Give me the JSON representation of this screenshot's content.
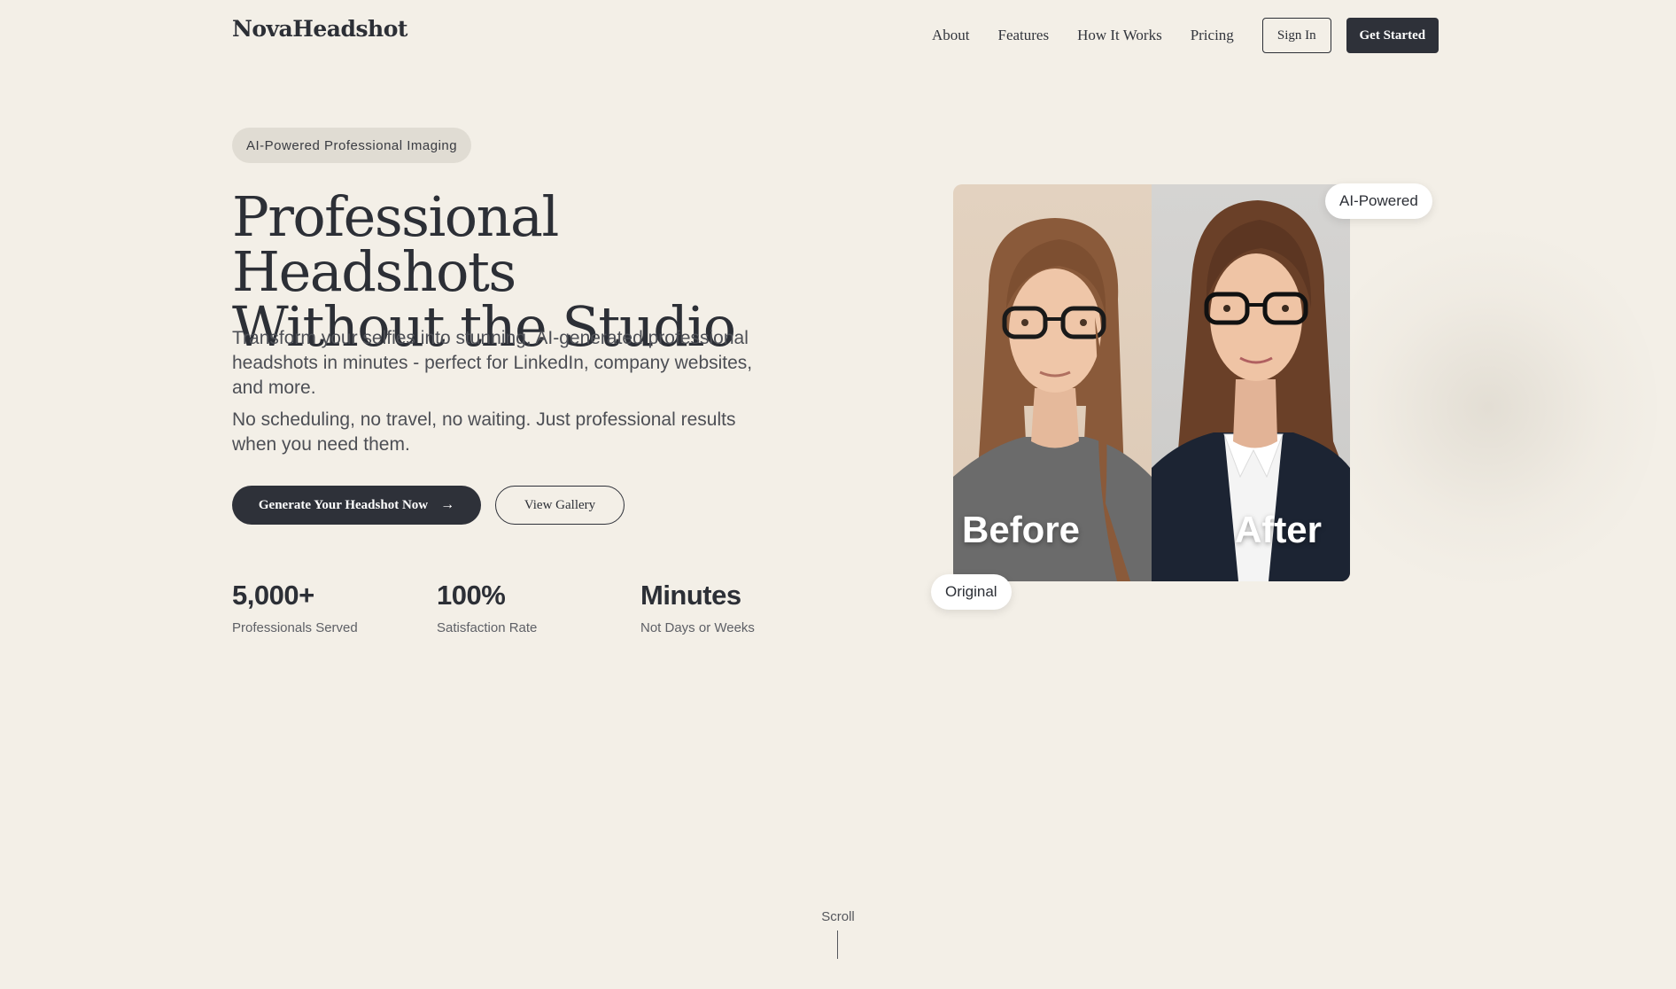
{
  "header": {
    "logo": "NovaHeadshot",
    "nav": [
      "About",
      "Features",
      "How It Works",
      "Pricing"
    ],
    "sign_in": "Sign In",
    "get_started": "Get Started"
  },
  "hero": {
    "pill": "AI-Powered Professional Imaging",
    "title_line1": "Professional Headshots",
    "title_line2": "Without the Studio",
    "description1": "Transform your selfies into stunning, AI-generated professional headshots in minutes - perfect for LinkedIn, company websites, and more.",
    "description2": "No scheduling, no travel, no waiting. Just professional results when you need them.",
    "cta_primary": "Generate Your Headshot Now",
    "cta_secondary": "View Gallery",
    "stats": [
      {
        "value": "5,000+",
        "label": "Professionals Served"
      },
      {
        "value": "100%",
        "label": "Satisfaction Rate"
      },
      {
        "value": "Minutes",
        "label": "Not Days or Weeks"
      }
    ]
  },
  "image": {
    "before_label": "Before",
    "after_label": "After",
    "badge_top": "AI-Powered",
    "badge_bottom": "Original"
  },
  "scroll": {
    "label": "Scroll"
  },
  "icons": {
    "cta_arrow": "arrow-right-icon"
  },
  "colors": {
    "background": "#f3efe7",
    "dark": "#2e3139",
    "pill": "#e0dcd3"
  }
}
